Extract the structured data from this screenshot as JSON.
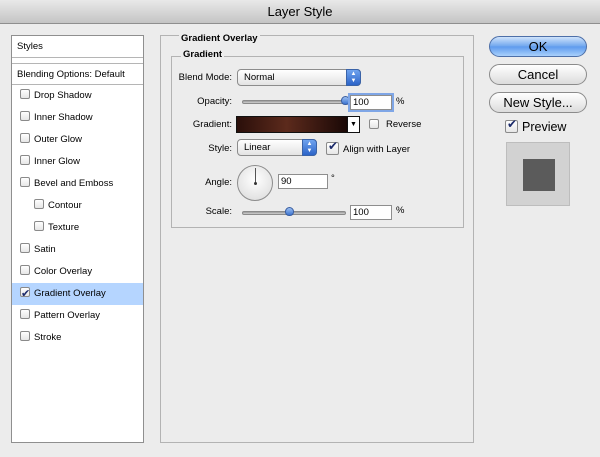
{
  "window": {
    "title": "Layer Style"
  },
  "styles_list": {
    "header": "Styles",
    "blending": "Blending Options: Default",
    "items": [
      {
        "label": "Drop Shadow",
        "checked": false,
        "indent": false
      },
      {
        "label": "Inner Shadow",
        "checked": false,
        "indent": false
      },
      {
        "label": "Outer Glow",
        "checked": false,
        "indent": false
      },
      {
        "label": "Inner Glow",
        "checked": false,
        "indent": false
      },
      {
        "label": "Bevel and Emboss",
        "checked": false,
        "indent": false
      },
      {
        "label": "Contour",
        "checked": false,
        "indent": true
      },
      {
        "label": "Texture",
        "checked": false,
        "indent": true
      },
      {
        "label": "Satin",
        "checked": false,
        "indent": false
      },
      {
        "label": "Color Overlay",
        "checked": false,
        "indent": false
      },
      {
        "label": "Gradient Overlay",
        "checked": true,
        "indent": false,
        "selected": true
      },
      {
        "label": "Pattern Overlay",
        "checked": false,
        "indent": false
      },
      {
        "label": "Stroke",
        "checked": false,
        "indent": false
      }
    ]
  },
  "panel": {
    "title": "Gradient Overlay",
    "group_title": "Gradient",
    "blend_mode": {
      "label": "Blend Mode:",
      "value": "Normal"
    },
    "opacity": {
      "label": "Opacity:",
      "value": "100",
      "unit": "%",
      "level": 1.0
    },
    "gradient": {
      "label": "Gradient:",
      "from_color": "#2a0f0a",
      "mid_color": "#5c2a1c",
      "to_color": "#1a0806",
      "reverse_label": "Reverse",
      "reverse_checked": false
    },
    "style": {
      "label": "Style:",
      "value": "Linear",
      "align_label": "Align with Layer",
      "align_checked": true
    },
    "angle": {
      "label": "Angle:",
      "value": "90",
      "unit": "°"
    },
    "scale": {
      "label": "Scale:",
      "value": "100",
      "unit": "%",
      "level": 0.46
    }
  },
  "buttons": {
    "ok": "OK",
    "cancel": "Cancel",
    "new_style": "New Style..."
  },
  "preview": {
    "label": "Preview",
    "checked": true
  }
}
